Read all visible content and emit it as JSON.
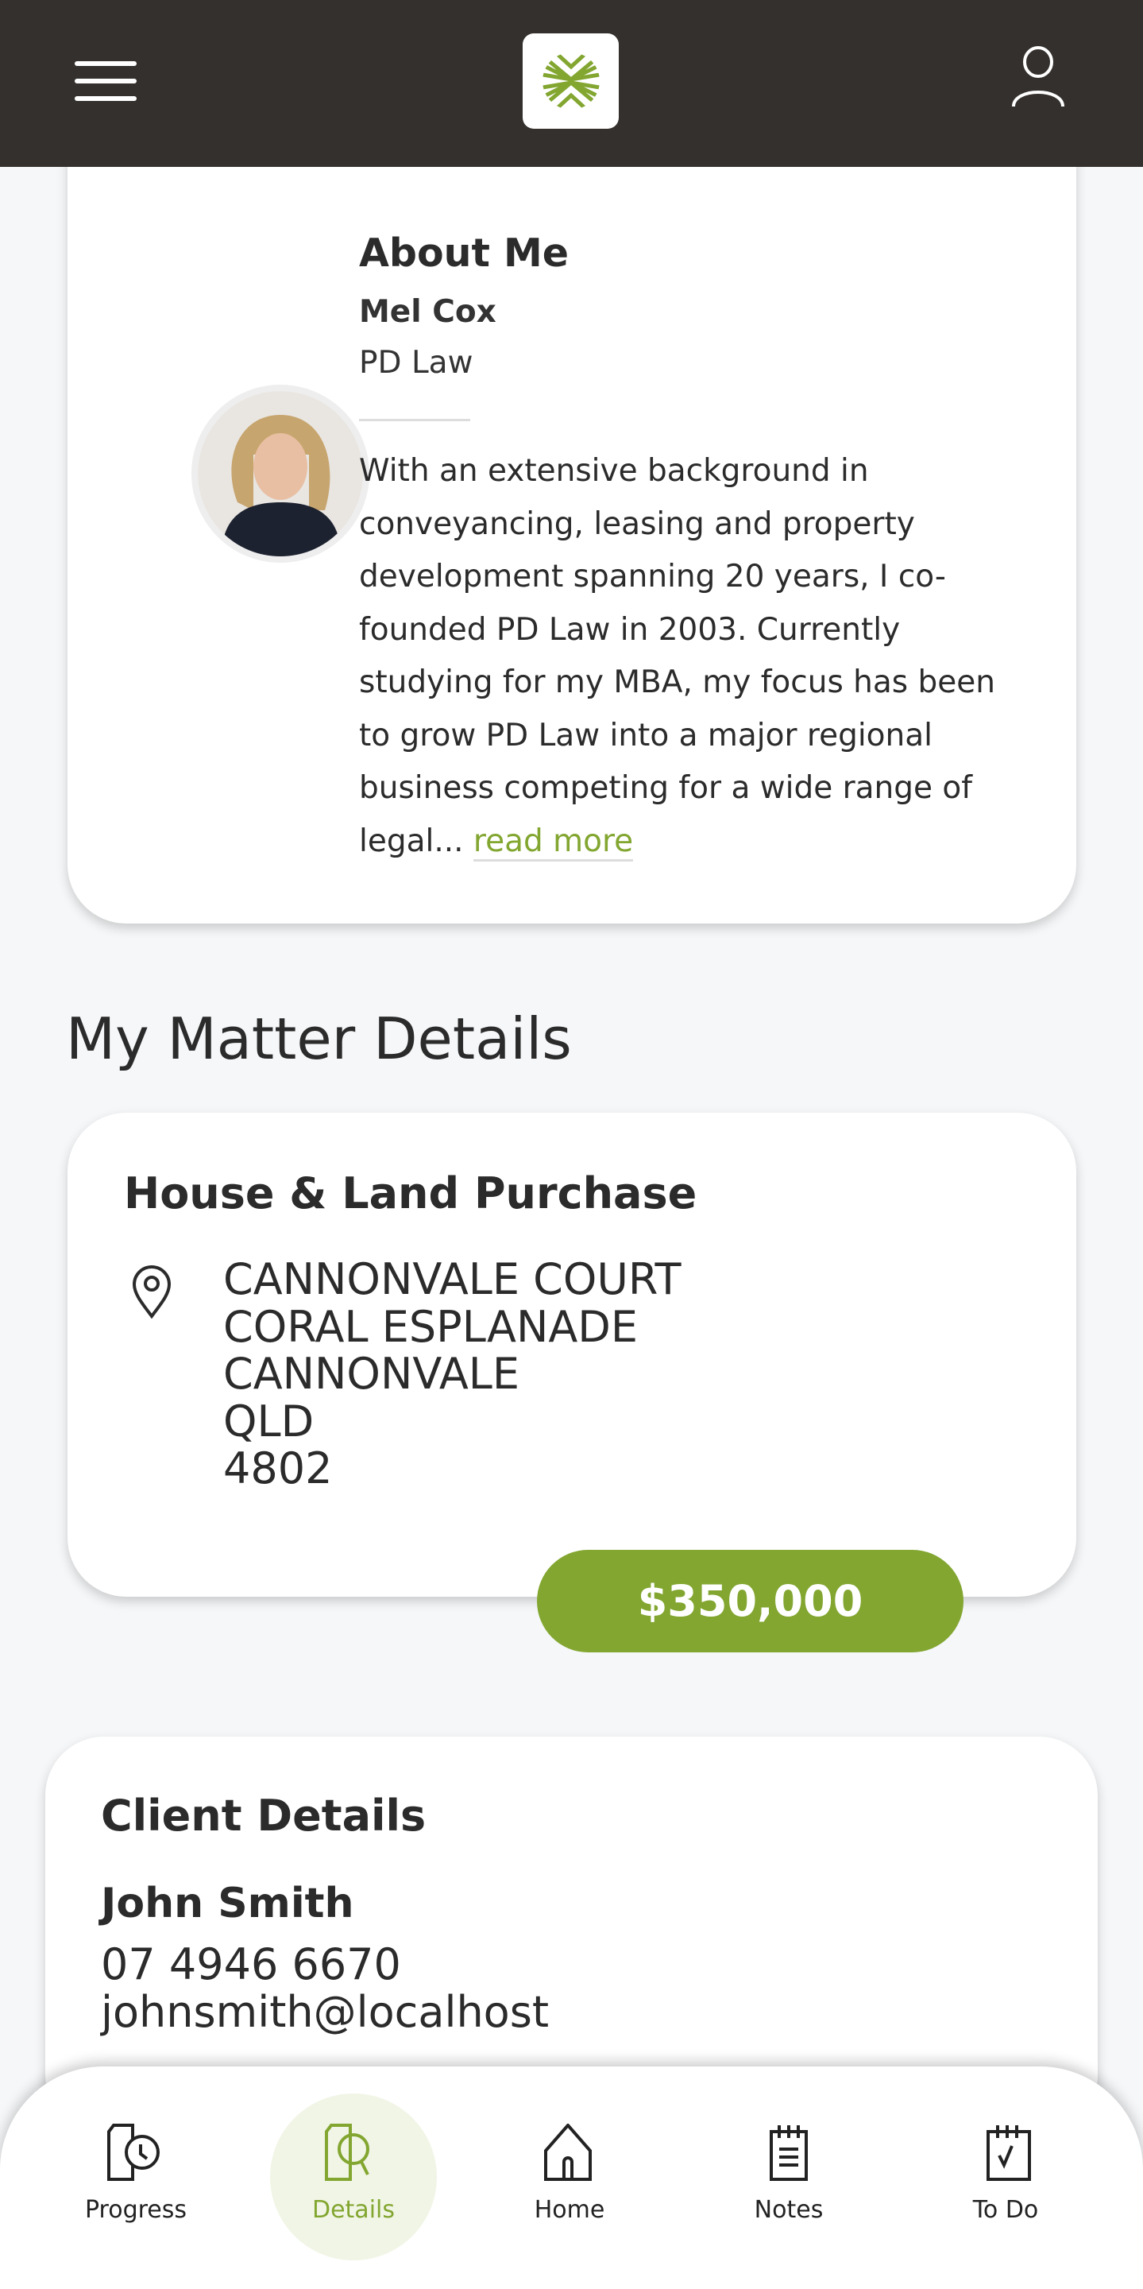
{
  "header": {
    "menu_icon": "hamburger-icon",
    "logo_icon": "pd-law-logo",
    "user_icon": "user-icon"
  },
  "about": {
    "title": "About Me",
    "name": "Mel Cox",
    "firm": "PD Law",
    "bio": "With an extensive background in conveyancing, leasing and property development spanning 20 years, I co-founded PD Law in 2003. Currently studying for my MBA, my focus has been to grow PD Law into a major regional business competing for a wide range of legal...",
    "read_more": "read more"
  },
  "matter": {
    "section_title": "My Matter Details",
    "title": "House & Land Purchase",
    "address": [
      "CANNONVALE COURT",
      "CORAL ESPLANADE",
      "CANNONVALE",
      "QLD",
      "4802"
    ],
    "price": "$350,000"
  },
  "client": {
    "title": "Client Details",
    "name": "John Smith",
    "phone": "07 4946 6670",
    "email": "johnsmith@localhost"
  },
  "nav": {
    "items": [
      {
        "label": "Progress",
        "icon": "document-clock-icon"
      },
      {
        "label": "Details",
        "icon": "document-search-icon",
        "active": true
      },
      {
        "label": "Home",
        "icon": "home-icon"
      },
      {
        "label": "Notes",
        "icon": "notepad-icon"
      },
      {
        "label": "To Do",
        "icon": "checklist-icon"
      }
    ]
  },
  "colors": {
    "header": "#34302d",
    "accent": "#82a630",
    "active_bg": "#f1f5e6",
    "background": "#f5f7f9"
  }
}
